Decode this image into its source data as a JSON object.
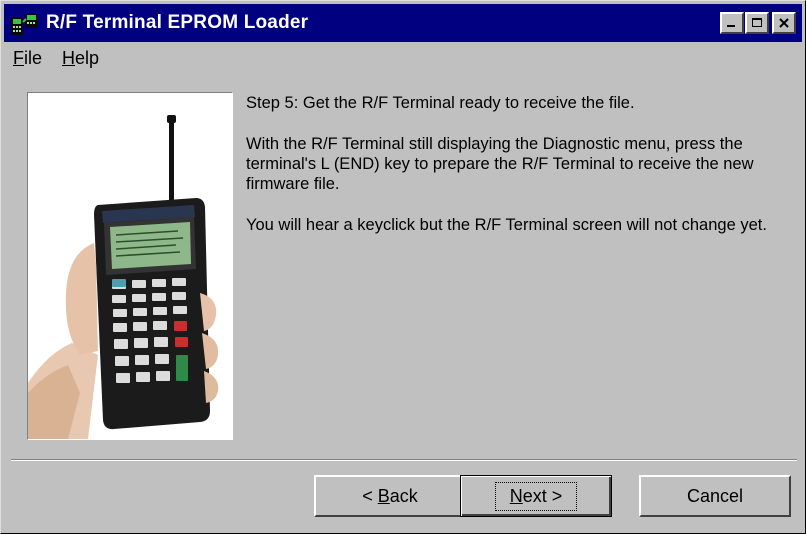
{
  "window": {
    "title": "R/F Terminal EPROM Loader",
    "icon": "terminal-app-icon",
    "controls": [
      "minimize-icon",
      "maximize-icon",
      "close-icon"
    ]
  },
  "menu": {
    "file": {
      "label_rest": "ile",
      "mnemonic": "F"
    },
    "help": {
      "label_rest": "elp",
      "mnemonic": "H"
    }
  },
  "content": {
    "step_heading": "Step 5: Get the R/F Terminal ready to receive the file.",
    "paragraph1": "With the R/F Terminal still displaying the Diagnostic menu, press the terminal's L (END) key to prepare the R/F Terminal to receive the new firmware file.",
    "paragraph2": "You will hear a keyclick but the R/F Terminal screen will not change yet."
  },
  "buttons": {
    "back": {
      "prefix": "< ",
      "mnemonic": "B",
      "rest": "ack"
    },
    "next": {
      "mnemonic": "N",
      "rest": "ext >"
    },
    "cancel": {
      "label": "Cancel"
    }
  },
  "colors": {
    "titlebar": "#000080",
    "face": "#c0c0c0"
  }
}
